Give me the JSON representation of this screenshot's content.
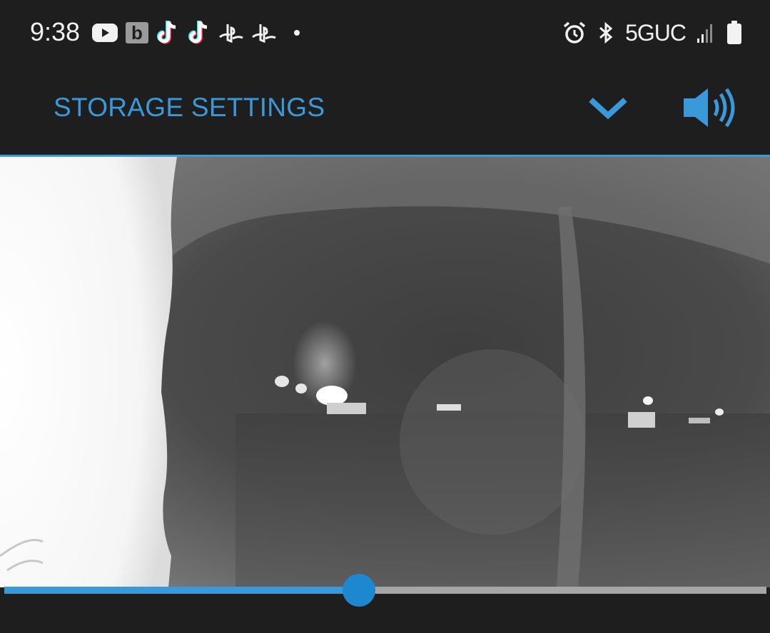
{
  "status_bar": {
    "time": "9:38",
    "b_badge": "b",
    "network": "5GUC",
    "left_icons": [
      "youtube-icon",
      "b-app-icon",
      "tiktok-icon",
      "tiktok-icon",
      "playstation-icon",
      "playstation-icon",
      "notification-dot-icon"
    ],
    "right_icons": [
      "alarm-icon",
      "bluetooth-icon",
      "signal-icon",
      "battery-icon"
    ]
  },
  "app_bar": {
    "title": "STORAGE SETTINGS",
    "actions": [
      "chevron-down-icon",
      "volume-icon"
    ]
  },
  "video": {
    "description_icon": "night-camera-feed",
    "progress": 0.465
  },
  "colors": {
    "accent": "#3a99d8",
    "thumb": "#1d87cf",
    "background": "#1e1e1f",
    "track": "#a6a6a6"
  }
}
